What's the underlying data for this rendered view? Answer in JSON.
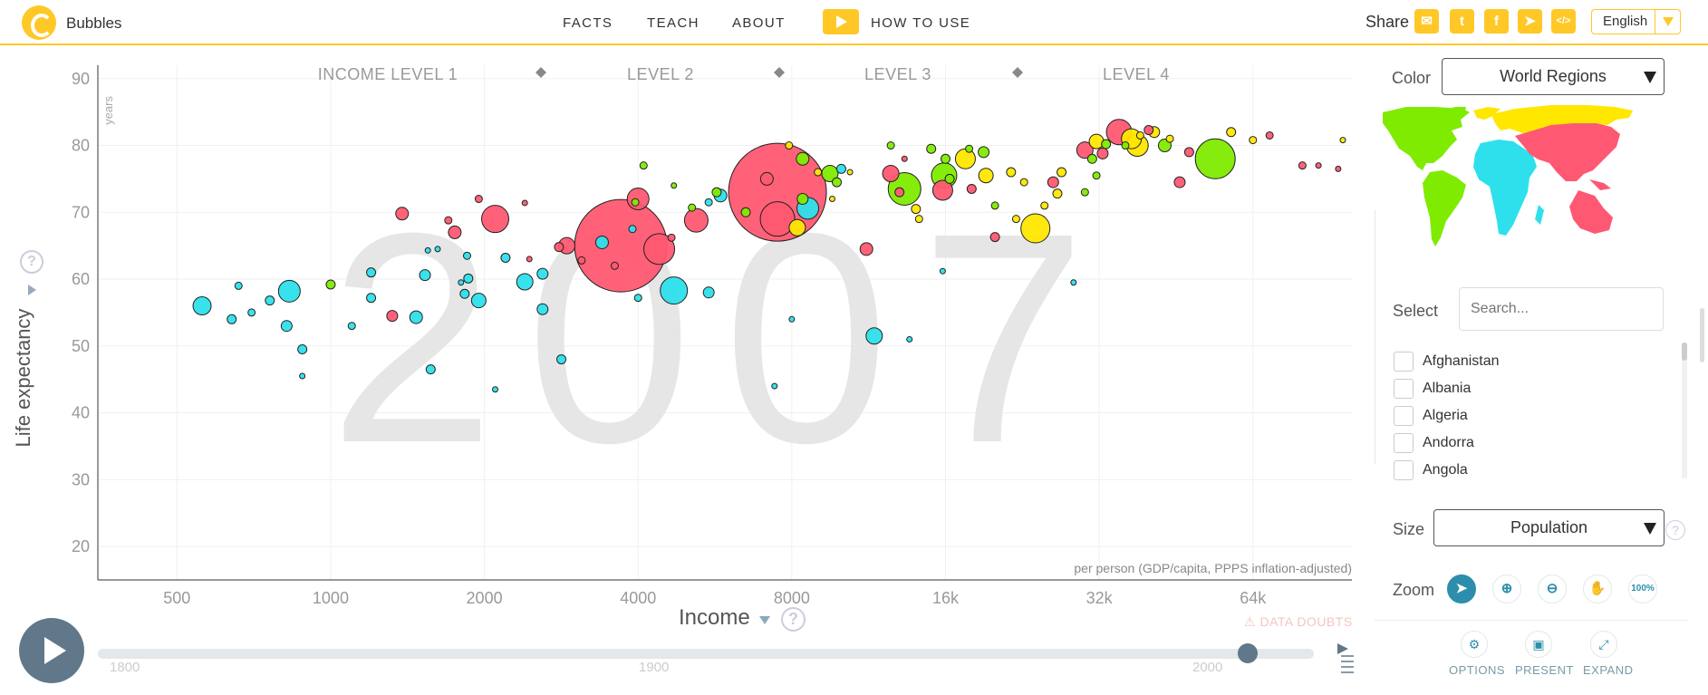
{
  "header": {
    "app_title": "Bubbles",
    "nav": [
      "FACTS",
      "TEACH",
      "ABOUT"
    ],
    "how_to_use": "HOW TO USE",
    "share_label": "Share",
    "share_icons": [
      "mail-icon",
      "twitter-icon",
      "facebook-icon",
      "telegram-icon",
      "embed-icon"
    ],
    "share_glyphs": [
      "✉",
      "t",
      "f",
      "➤",
      "</>"
    ],
    "language": "English"
  },
  "chart": {
    "year": "2007",
    "income_levels": [
      "INCOME LEVEL 1",
      "LEVEL 2",
      "LEVEL 3",
      "LEVEL 4"
    ],
    "y_unit": "years",
    "ylabel": "Life expectancy",
    "xlabel": "Income",
    "x_sublabel": "per person (GDP/capita, PPPS inflation-adjusted)",
    "data_doubts": "⚠ DATA DOUBTS",
    "help": "?"
  },
  "chart_data": {
    "type": "scatter",
    "title": "",
    "xlabel": "Income",
    "ylabel": "Life expectancy",
    "x_scale": "log",
    "xlim": [
      350,
      100000
    ],
    "ylim": [
      15,
      92
    ],
    "x_ticks": [
      500,
      1000,
      2000,
      4000,
      8000,
      16000,
      32000,
      64000
    ],
    "x_tick_labels": [
      "500",
      "1000",
      "2000",
      "4000",
      "8000",
      "16k",
      "32k",
      "64k"
    ],
    "y_ticks": [
      20,
      30,
      40,
      50,
      60,
      70,
      80,
      90
    ],
    "grid": true,
    "legend": "none",
    "colors": {
      "africa": "#2de0ec",
      "asia": "#ff5872",
      "americas": "#7feb00",
      "europe": "#ffe700"
    },
    "points": [
      {
        "x": 7500,
        "y": 73,
        "r": 54,
        "c": "asia"
      },
      {
        "x": 3700,
        "y": 65,
        "r": 51,
        "c": "asia"
      },
      {
        "x": 54000,
        "y": 78,
        "r": 22,
        "c": "americas"
      },
      {
        "x": 7500,
        "y": 69,
        "r": 19,
        "c": "asia"
      },
      {
        "x": 4400,
        "y": 64.5,
        "r": 17,
        "c": "asia"
      },
      {
        "x": 2100,
        "y": 69,
        "r": 15,
        "c": "asia"
      },
      {
        "x": 4700,
        "y": 58.3,
        "r": 15,
        "c": "africa"
      },
      {
        "x": 13300,
        "y": 73.5,
        "r": 18,
        "c": "americas"
      },
      {
        "x": 15900,
        "y": 75.5,
        "r": 14,
        "c": "americas"
      },
      {
        "x": 24000,
        "y": 67.6,
        "r": 16,
        "c": "europe"
      },
      {
        "x": 35000,
        "y": 82,
        "r": 14,
        "c": "asia"
      },
      {
        "x": 38000,
        "y": 80,
        "r": 12,
        "c": "europe"
      },
      {
        "x": 37000,
        "y": 81,
        "r": 11,
        "c": "europe"
      },
      {
        "x": 4000,
        "y": 72,
        "r": 12,
        "c": "asia"
      },
      {
        "x": 5200,
        "y": 68.8,
        "r": 13,
        "c": "asia"
      },
      {
        "x": 830,
        "y": 58.2,
        "r": 12,
        "c": "africa"
      },
      {
        "x": 8600,
        "y": 70.6,
        "r": 12,
        "c": "africa"
      },
      {
        "x": 15800,
        "y": 73.3,
        "r": 11,
        "c": "asia"
      },
      {
        "x": 17500,
        "y": 78,
        "r": 11,
        "c": "europe"
      },
      {
        "x": 560,
        "y": 56,
        "r": 10,
        "c": "africa"
      },
      {
        "x": 2900,
        "y": 65,
        "r": 9,
        "c": "asia"
      },
      {
        "x": 2400,
        "y": 59.6,
        "r": 9,
        "c": "africa"
      },
      {
        "x": 1950,
        "y": 56.8,
        "r": 8,
        "c": "africa"
      },
      {
        "x": 11600,
        "y": 51.5,
        "r": 9,
        "c": "africa"
      },
      {
        "x": 12500,
        "y": 75.8,
        "r": 9,
        "c": "asia"
      },
      {
        "x": 9500,
        "y": 75.8,
        "r": 9,
        "c": "americas"
      },
      {
        "x": 8200,
        "y": 67.7,
        "r": 9,
        "c": "europe"
      },
      {
        "x": 30000,
        "y": 79.3,
        "r": 9,
        "c": "asia"
      },
      {
        "x": 19200,
        "y": 75.5,
        "r": 8,
        "c": "europe"
      },
      {
        "x": 31600,
        "y": 80.6,
        "r": 8,
        "c": "europe"
      },
      {
        "x": 1470,
        "y": 54.3,
        "r": 7,
        "c": "africa"
      },
      {
        "x": 1380,
        "y": 69.8,
        "r": 7,
        "c": "asia"
      },
      {
        "x": 1750,
        "y": 67,
        "r": 7,
        "c": "asia"
      },
      {
        "x": 2600,
        "y": 55.5,
        "r": 6,
        "c": "africa"
      },
      {
        "x": 2600,
        "y": 60.8,
        "r": 6,
        "c": "africa"
      },
      {
        "x": 3400,
        "y": 65.5,
        "r": 7,
        "c": "africa"
      },
      {
        "x": 7150,
        "y": 75,
        "r": 7,
        "c": "asia"
      },
      {
        "x": 8400,
        "y": 78,
        "r": 7,
        "c": "americas"
      },
      {
        "x": 11200,
        "y": 64.5,
        "r": 7,
        "c": "asia"
      },
      {
        "x": 5800,
        "y": 72.5,
        "r": 7,
        "c": "africa"
      },
      {
        "x": 43000,
        "y": 80,
        "r": 7,
        "c": "americas"
      },
      {
        "x": 46000,
        "y": 74.5,
        "r": 6,
        "c": "asia"
      },
      {
        "x": 19000,
        "y": 79,
        "r": 6,
        "c": "americas"
      },
      {
        "x": 18000,
        "y": 73.5,
        "r": 5,
        "c": "asia"
      },
      {
        "x": 41000,
        "y": 82,
        "r": 6,
        "c": "europe"
      },
      {
        "x": 32500,
        "y": 78.8,
        "r": 6,
        "c": "asia"
      },
      {
        "x": 26000,
        "y": 74.5,
        "r": 6,
        "c": "asia"
      },
      {
        "x": 5700,
        "y": 73,
        "r": 5,
        "c": "americas"
      },
      {
        "x": 6500,
        "y": 70,
        "r": 5,
        "c": "americas"
      },
      {
        "x": 640,
        "y": 54,
        "r": 5,
        "c": "africa"
      },
      {
        "x": 700,
        "y": 55,
        "r": 4,
        "c": "africa"
      },
      {
        "x": 760,
        "y": 56.8,
        "r": 5,
        "c": "africa"
      },
      {
        "x": 820,
        "y": 53,
        "r": 6,
        "c": "africa"
      },
      {
        "x": 880,
        "y": 49.5,
        "r": 5,
        "c": "africa"
      },
      {
        "x": 1200,
        "y": 57.2,
        "r": 5,
        "c": "africa"
      },
      {
        "x": 1320,
        "y": 54.5,
        "r": 6,
        "c": "asia"
      },
      {
        "x": 1530,
        "y": 60.6,
        "r": 6,
        "c": "africa"
      },
      {
        "x": 1570,
        "y": 46.5,
        "r": 5,
        "c": "africa"
      },
      {
        "x": 1830,
        "y": 57.8,
        "r": 5,
        "c": "africa"
      },
      {
        "x": 1860,
        "y": 60.1,
        "r": 5,
        "c": "africa"
      },
      {
        "x": 2830,
        "y": 48,
        "r": 5,
        "c": "africa"
      },
      {
        "x": 3900,
        "y": 67.5,
        "r": 4,
        "c": "africa"
      },
      {
        "x": 4000,
        "y": 57.2,
        "r": 4,
        "c": "africa"
      },
      {
        "x": 5500,
        "y": 58,
        "r": 6,
        "c": "africa"
      },
      {
        "x": 3100,
        "y": 62.8,
        "r": 4,
        "c": "asia"
      },
      {
        "x": 2800,
        "y": 64.8,
        "r": 5,
        "c": "asia"
      },
      {
        "x": 1950,
        "y": 72,
        "r": 4,
        "c": "asia"
      },
      {
        "x": 1200,
        "y": 61,
        "r": 5,
        "c": "africa"
      },
      {
        "x": 1100,
        "y": 53,
        "r": 4,
        "c": "africa"
      },
      {
        "x": 1000,
        "y": 59.2,
        "r": 5,
        "c": "americas"
      },
      {
        "x": 1700,
        "y": 68.8,
        "r": 4,
        "c": "asia"
      },
      {
        "x": 660,
        "y": 59,
        "r": 4,
        "c": "africa"
      },
      {
        "x": 1850,
        "y": 63.5,
        "r": 4,
        "c": "africa"
      },
      {
        "x": 8400,
        "y": 72,
        "r": 6,
        "c": "americas"
      },
      {
        "x": 9800,
        "y": 74.5,
        "r": 5,
        "c": "americas"
      },
      {
        "x": 10000,
        "y": 76.5,
        "r": 5,
        "c": "africa"
      },
      {
        "x": 13000,
        "y": 73,
        "r": 5,
        "c": "asia"
      },
      {
        "x": 14000,
        "y": 70.5,
        "r": 5,
        "c": "europe"
      },
      {
        "x": 14200,
        "y": 69,
        "r": 4,
        "c": "europe"
      },
      {
        "x": 16300,
        "y": 75,
        "r": 5,
        "c": "americas"
      },
      {
        "x": 20000,
        "y": 71,
        "r": 4,
        "c": "americas"
      },
      {
        "x": 21500,
        "y": 76,
        "r": 5,
        "c": "europe"
      },
      {
        "x": 22000,
        "y": 69,
        "r": 4,
        "c": "europe"
      },
      {
        "x": 25000,
        "y": 71,
        "r": 4,
        "c": "europe"
      },
      {
        "x": 26500,
        "y": 72.8,
        "r": 5,
        "c": "europe"
      },
      {
        "x": 27000,
        "y": 76,
        "r": 5,
        "c": "europe"
      },
      {
        "x": 22800,
        "y": 74.5,
        "r": 4,
        "c": "europe"
      },
      {
        "x": 20000,
        "y": 66.3,
        "r": 5,
        "c": "asia"
      },
      {
        "x": 30000,
        "y": 73,
        "r": 4,
        "c": "americas"
      },
      {
        "x": 31000,
        "y": 78,
        "r": 5,
        "c": "americas"
      },
      {
        "x": 31600,
        "y": 75.5,
        "r": 4,
        "c": "americas"
      },
      {
        "x": 33000,
        "y": 80.2,
        "r": 5,
        "c": "americas"
      },
      {
        "x": 48000,
        "y": 79,
        "r": 5,
        "c": "asia"
      },
      {
        "x": 58000,
        "y": 82,
        "r": 5,
        "c": "europe"
      },
      {
        "x": 64000,
        "y": 80.8,
        "r": 4,
        "c": "europe"
      },
      {
        "x": 69000,
        "y": 81.5,
        "r": 4,
        "c": "asia"
      },
      {
        "x": 80000,
        "y": 77,
        "r": 4,
        "c": "asia"
      },
      {
        "x": 94000,
        "y": 76.5,
        "r": 3,
        "c": "asia"
      },
      {
        "x": 96000,
        "y": 80.8,
        "r": 3,
        "c": "europe"
      },
      {
        "x": 86000,
        "y": 77,
        "r": 3,
        "c": "asia"
      },
      {
        "x": 13600,
        "y": 51,
        "r": 3,
        "c": "africa"
      },
      {
        "x": 8000,
        "y": 54,
        "r": 3,
        "c": "africa"
      },
      {
        "x": 7400,
        "y": 44,
        "r": 3,
        "c": "africa"
      },
      {
        "x": 15800,
        "y": 61.2,
        "r": 3,
        "c": "africa"
      },
      {
        "x": 28500,
        "y": 59.5,
        "r": 3,
        "c": "africa"
      },
      {
        "x": 2100,
        "y": 43.5,
        "r": 3,
        "c": "africa"
      },
      {
        "x": 880,
        "y": 45.5,
        "r": 3,
        "c": "africa"
      },
      {
        "x": 4100,
        "y": 77,
        "r": 4,
        "c": "americas"
      },
      {
        "x": 4700,
        "y": 74,
        "r": 3,
        "c": "americas"
      },
      {
        "x": 4650,
        "y": 66.2,
        "r": 4,
        "c": "asia"
      },
      {
        "x": 5100,
        "y": 70.7,
        "r": 4,
        "c": "americas"
      },
      {
        "x": 5500,
        "y": 71.5,
        "r": 4,
        "c": "africa"
      },
      {
        "x": 3950,
        "y": 71.5,
        "r": 4,
        "c": "americas"
      },
      {
        "x": 3600,
        "y": 62,
        "r": 4,
        "c": "asia"
      },
      {
        "x": 2400,
        "y": 71.4,
        "r": 3,
        "c": "asia"
      },
      {
        "x": 2200,
        "y": 63.2,
        "r": 5,
        "c": "africa"
      },
      {
        "x": 2450,
        "y": 63,
        "r": 3,
        "c": "asia"
      },
      {
        "x": 1550,
        "y": 64.3,
        "r": 3,
        "c": "africa"
      },
      {
        "x": 1620,
        "y": 64.5,
        "r": 3,
        "c": "africa"
      },
      {
        "x": 1800,
        "y": 59.5,
        "r": 3,
        "c": "africa"
      },
      {
        "x": 7900,
        "y": 80,
        "r": 4,
        "c": "europe"
      },
      {
        "x": 9000,
        "y": 76,
        "r": 4,
        "c": "europe"
      },
      {
        "x": 9600,
        "y": 72,
        "r": 3,
        "c": "europe"
      },
      {
        "x": 10400,
        "y": 76,
        "r": 3,
        "c": "europe"
      },
      {
        "x": 12500,
        "y": 80,
        "r": 4,
        "c": "americas"
      },
      {
        "x": 13300,
        "y": 78,
        "r": 3,
        "c": "asia"
      },
      {
        "x": 15000,
        "y": 79.5,
        "r": 5,
        "c": "americas"
      },
      {
        "x": 16000,
        "y": 78,
        "r": 5,
        "c": "americas"
      },
      {
        "x": 17800,
        "y": 79.5,
        "r": 4,
        "c": "americas"
      },
      {
        "x": 36000,
        "y": 80,
        "r": 4,
        "c": "americas"
      },
      {
        "x": 38500,
        "y": 81.5,
        "r": 4,
        "c": "europe"
      },
      {
        "x": 40000,
        "y": 82.3,
        "r": 5,
        "c": "asia"
      },
      {
        "x": 44000,
        "y": 81,
        "r": 4,
        "c": "europe"
      }
    ]
  },
  "timeslider": {
    "labels": [
      "1800",
      "1900",
      "2000"
    ],
    "start_year": 1800,
    "end_year": 2018,
    "current_year": 2007
  },
  "panel": {
    "color_label": "Color",
    "color_value": "World Regions",
    "select_label": "Select",
    "search_placeholder": "Search...",
    "countries": [
      "Afghanistan",
      "Albania",
      "Algeria",
      "Andorra",
      "Angola"
    ],
    "size_label": "Size",
    "size_value": "Population",
    "zoom_label": "Zoom",
    "zoom_buttons": [
      "pointer-icon",
      "zoom-in-icon",
      "zoom-out-icon",
      "hand-icon",
      "100%"
    ],
    "zoom_glyphs": [
      "➤",
      "⊕",
      "⊖",
      "✋",
      "100%"
    ],
    "bottom_buttons": [
      "OPTIONS",
      "PRESENT",
      "EXPAND"
    ],
    "bottom_glyphs": [
      "⚙",
      "▣",
      "⤢"
    ]
  }
}
